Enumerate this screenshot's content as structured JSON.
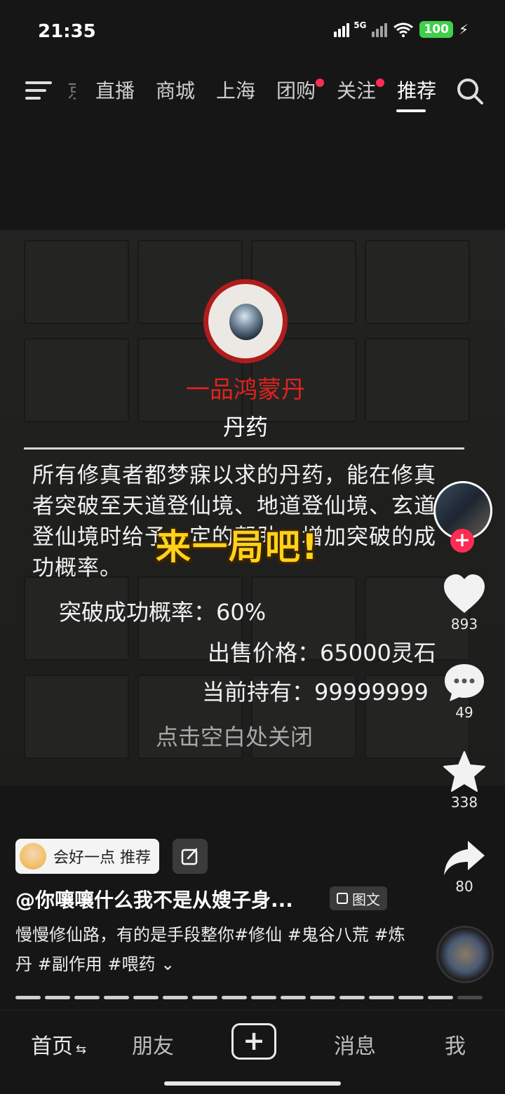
{
  "status_bar": {
    "time": "21:35",
    "network": "5G",
    "battery": "100"
  },
  "top_nav": {
    "cut_tab": "京",
    "tabs": [
      {
        "label": "直播",
        "dot": false
      },
      {
        "label": "商城",
        "dot": false
      },
      {
        "label": "上海",
        "dot": false
      },
      {
        "label": "团购",
        "dot": true
      },
      {
        "label": "关注",
        "dot": true
      },
      {
        "label": "推荐",
        "dot": false,
        "active": true
      }
    ]
  },
  "item_card": {
    "name": "一品鸿蒙丹",
    "type": "丹药",
    "description": "所有修真者都梦寐以求的丹药，能在修真者突破至天道登仙境、地道登仙境、玄道登仙境时给予一定的帮助，增加突破的成功概率。",
    "rate_label": "突破成功概率：60%",
    "price_label": "出售价格：65000灵石",
    "hold_label": "当前持有：99999999",
    "close_hint": "点击空白处关闭"
  },
  "overlay_caption": "来一局吧!",
  "actions": {
    "likes": "893",
    "comments": "49",
    "favorites": "338",
    "shares": "80"
  },
  "info": {
    "tag_chip": "会好一点 推荐",
    "title": "@你嚷嚷什么我不是从嫂子身...",
    "type_badge": "图文",
    "caption": "慢慢修仙路，有的是手段整你#修仙 #鬼谷八荒 #炼丹 #副作用 #喂药 ⌄"
  },
  "bottom_nav": {
    "home": "首页",
    "friends": "朋友",
    "messages": "消息",
    "me": "我"
  },
  "colors": {
    "accent_red": "#fe2c55",
    "item_name_red": "#e0231f",
    "overlay_yellow": "#ffd21a"
  },
  "icons": [
    "menu-icon",
    "search-icon",
    "heart-icon",
    "comment-icon",
    "star-icon",
    "share-icon",
    "edit-icon",
    "plus-icon"
  ]
}
